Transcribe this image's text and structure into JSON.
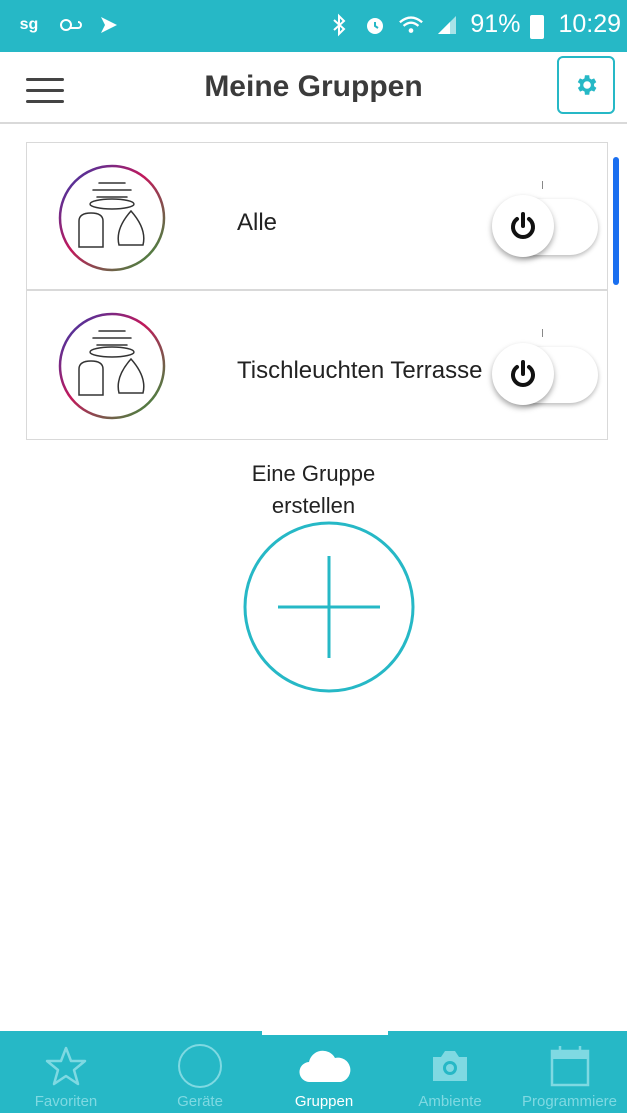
{
  "statusbar": {
    "carrier": "sg",
    "battery": "91%",
    "time": "10:29"
  },
  "appbar": {
    "title": "Meine Gruppen"
  },
  "groups": [
    {
      "name": "Alle",
      "power": "off"
    },
    {
      "name": "Tischleuchten Terrasse",
      "power": "off"
    }
  ],
  "create": {
    "label_line1": "Eine Gruppe",
    "label_line2": "erstellen"
  },
  "nav": {
    "items": [
      {
        "label": "Favoriten",
        "icon": "star-icon"
      },
      {
        "label": "Geräte",
        "icon": "circle-icon"
      },
      {
        "label": "Gruppen",
        "icon": "cloud-icon",
        "active": true
      },
      {
        "label": "Ambiente",
        "icon": "camera-icon"
      },
      {
        "label": "Programmiere",
        "icon": "calendar-icon"
      }
    ]
  },
  "colors": {
    "accent": "#26b8c6",
    "nav_inactive": "#7fd9e2",
    "scroll": "#1a6ff0"
  }
}
